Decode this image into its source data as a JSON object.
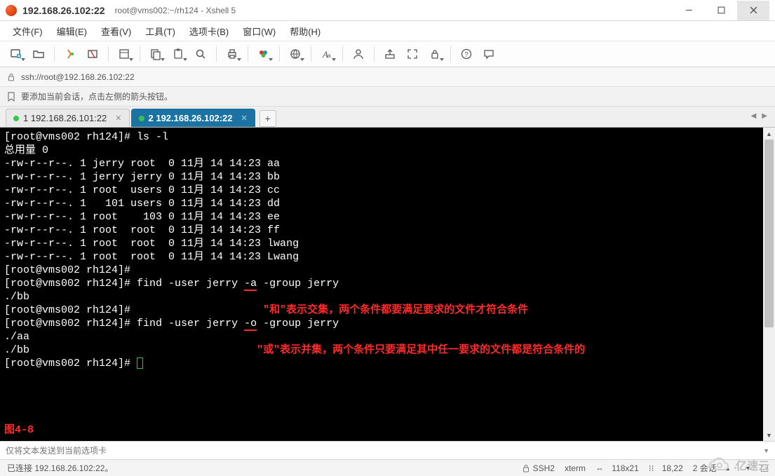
{
  "window": {
    "ip_title": "192.168.26.102:22",
    "subtitle": "root@vms002:~/rh124 - Xshell 5"
  },
  "menu": {
    "file": "文件(F)",
    "edit": "编辑(E)",
    "view": "查看(V)",
    "tools": "工具(T)",
    "tab": "选项卡(B)",
    "window": "窗口(W)",
    "help": "帮助(H)"
  },
  "address": {
    "text": "ssh://root@192.168.26.102:22"
  },
  "hint": {
    "text": "要添加当前会话，点击左侧的箭头按钮。"
  },
  "tabs": {
    "items": [
      {
        "label": "1 192.168.26.101:22",
        "active": false
      },
      {
        "label": "2 192.168.26.102:22",
        "active": true
      }
    ],
    "add": "+"
  },
  "terminal": {
    "prompt": "[root@vms002 rh124]#",
    "cmd_ls": "ls -l",
    "total": "总用量 0",
    "rows": [
      "-rw-r--r--. 1 jerry root  0 11月 14 14:23 aa",
      "-rw-r--r--. 1 jerry jerry 0 11月 14 14:23 bb",
      "-rw-r--r--. 1 root  users 0 11月 14 14:23 cc",
      "-rw-r--r--. 1   101 users 0 11月 14 14:23 dd",
      "-rw-r--r--. 1 root    103 0 11月 14 14:23 ee",
      "-rw-r--r--. 1 root  root  0 11月 14 14:23 ff",
      "-rw-r--r--. 1 root  root  0 11月 14 14:23 lwang",
      "-rw-r--r--. 1 root  root  0 11月 14 14:23 Lwang"
    ],
    "find1_pre": "find -user jerry ",
    "find1_op": "-a",
    "find1_post": " -group jerry",
    "find1_out": "./bb",
    "find2_pre": "find -user jerry ",
    "find2_op": "-o",
    "find2_post": " -group jerry",
    "find2_out1": "./aa",
    "find2_out2": "./bb",
    "ann_and": "\"和\"表示交集，两个条件都要满足要求的文件才符合条件",
    "ann_or": "\"或\"表示并集，两个条件只要满足其中任一要求的文件都是符合条件的",
    "fig": "图4-8"
  },
  "sendbar": {
    "placeholder": "仅将文本发送到当前选项卡"
  },
  "status": {
    "conn": "已连接 192.168.26.102:22。",
    "proto": "SSH2",
    "term": "xterm",
    "size": "118x21",
    "cursor": "18,22",
    "sessions": "2 会话",
    "size_icon": "⇔",
    "cursor_icon": "⁝⁝"
  },
  "watermark": {
    "text": "亿速云"
  }
}
